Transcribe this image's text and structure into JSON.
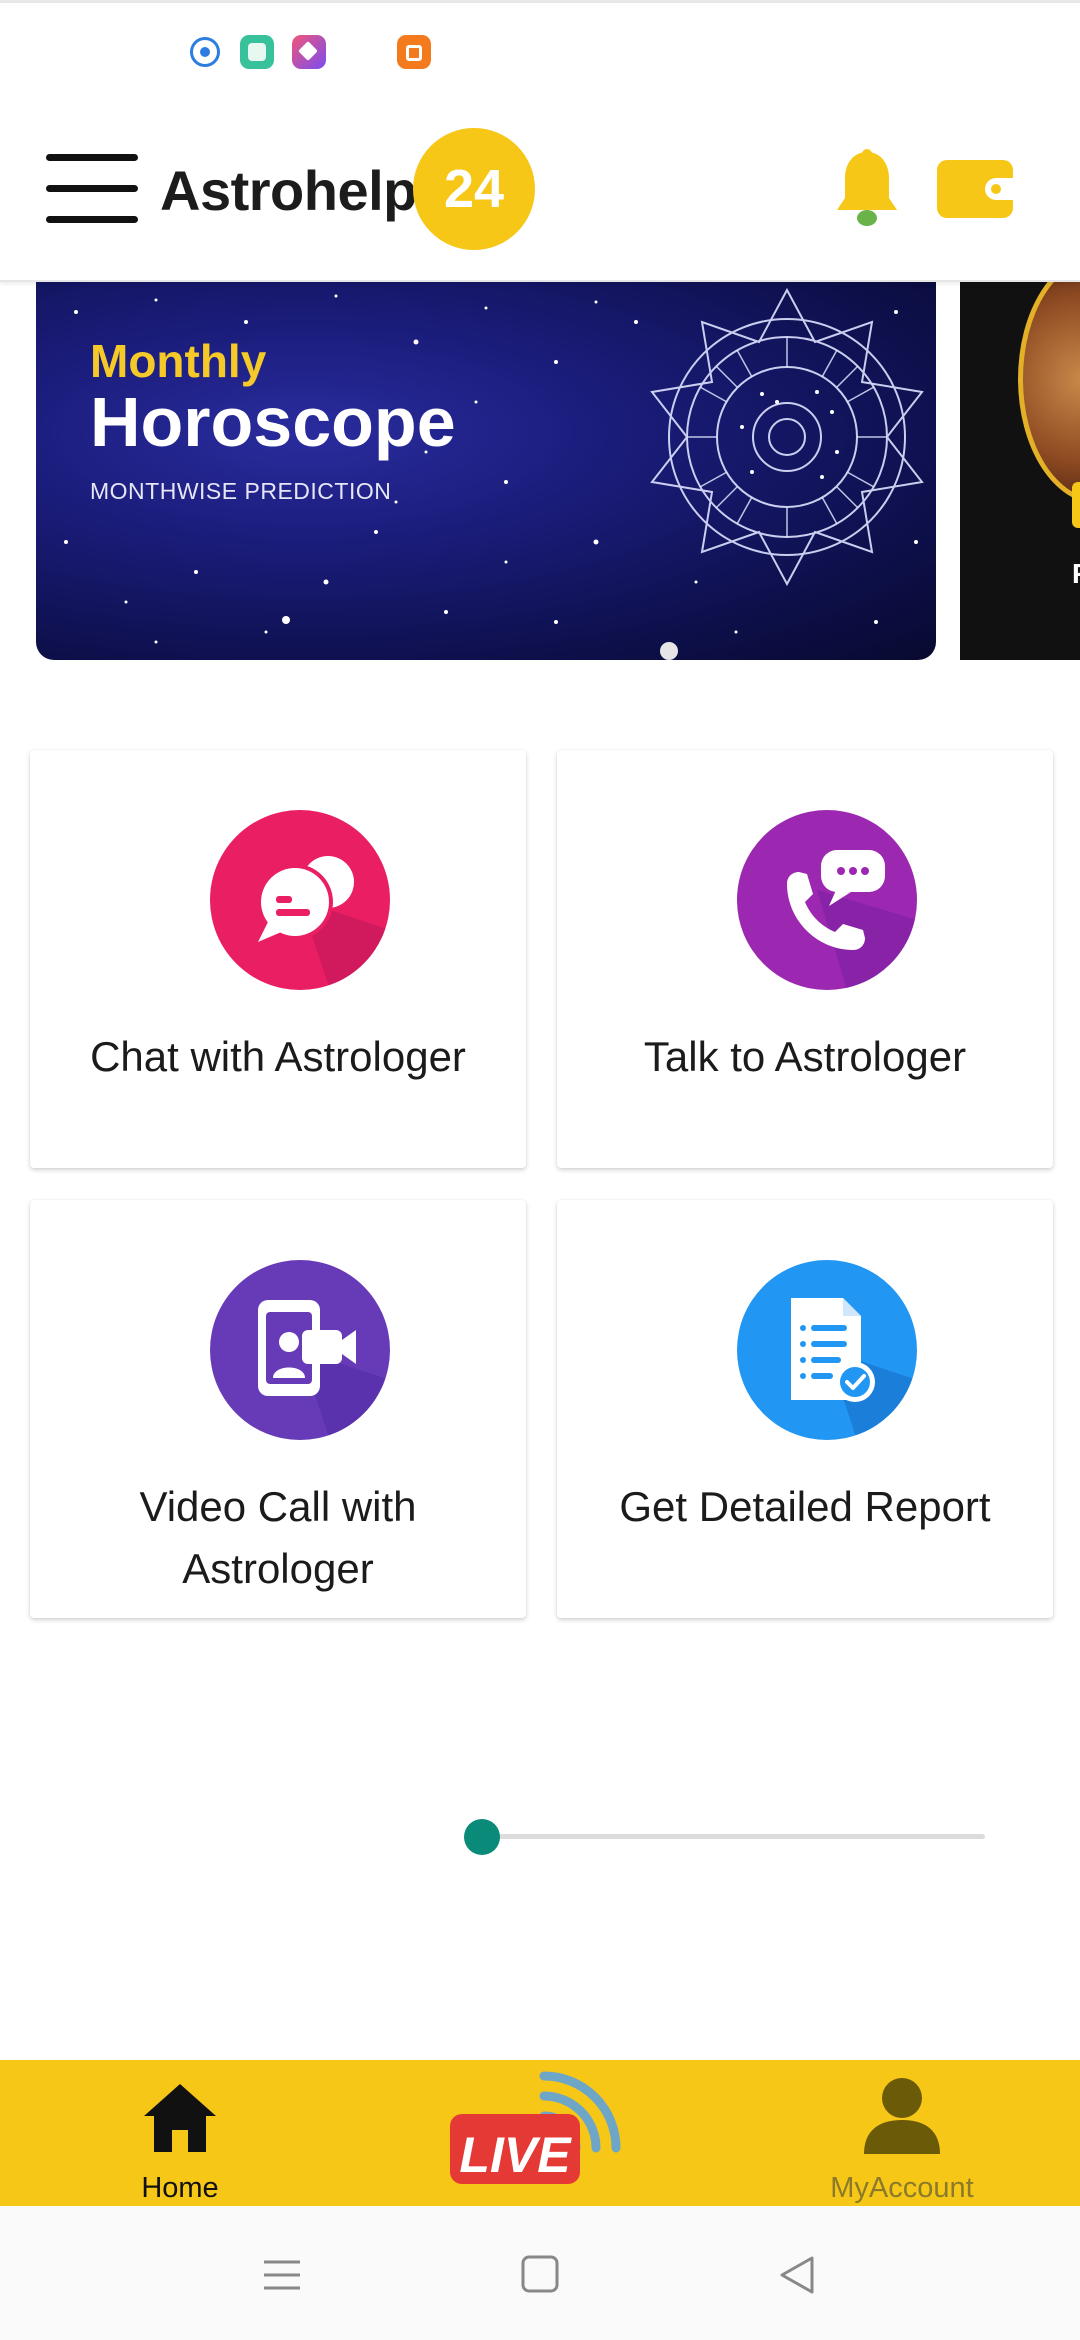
{
  "app": {
    "brand_name": "Astrohelp",
    "brand_badge": "24"
  },
  "colors": {
    "accent_yellow": "#f7c717",
    "chat_pink": "#e91e63",
    "talk_purple": "#9c27b0",
    "video_violet": "#673ab7",
    "report_blue": "#2196f3",
    "slider_teal": "#0a8a78"
  },
  "banner": {
    "kicker": "Monthly",
    "title": "Horoscope",
    "subtitle": "MONTHWISE PREDICTION",
    "peek_text": "F"
  },
  "features": [
    {
      "label": "Chat with Astrologer",
      "icon": "chat-bubbles-icon"
    },
    {
      "label": "Talk to Astrologer",
      "icon": "phone-chat-icon"
    },
    {
      "label": "Video Call with Astrologer",
      "icon": "video-call-icon"
    },
    {
      "label": "Get Detailed Report",
      "icon": "report-document-icon"
    }
  ],
  "slider": {
    "progress": 0.02
  },
  "bottom_nav": {
    "home_label": "Home",
    "live_label": "LIVE",
    "account_label": "MyAccount"
  }
}
